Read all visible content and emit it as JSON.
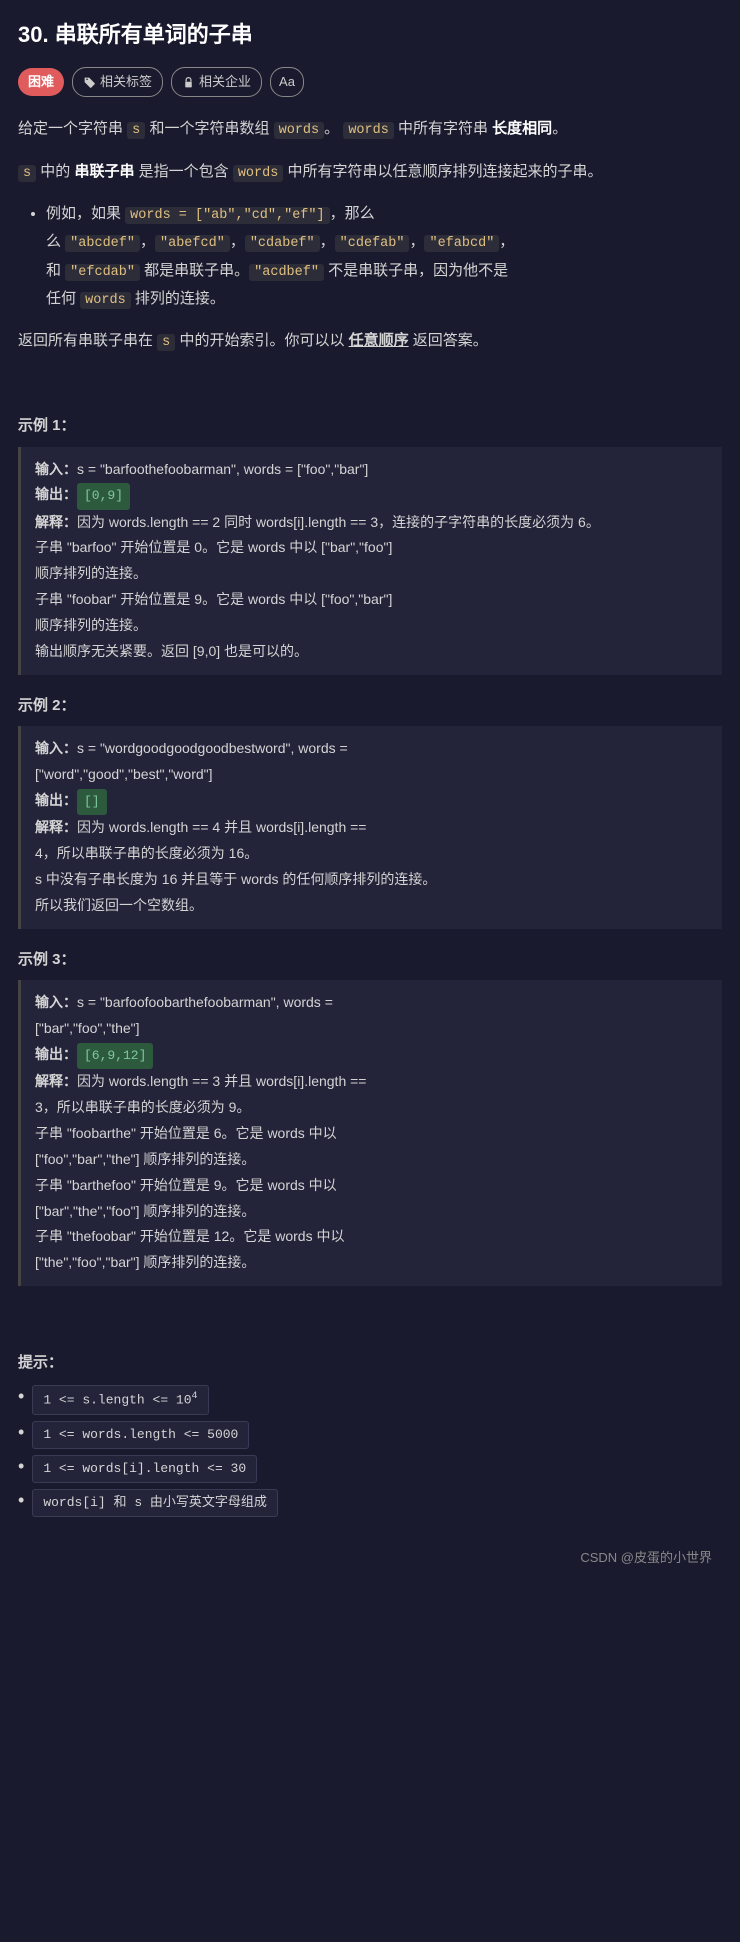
{
  "page": {
    "title": "30. 串联所有单词的子串",
    "difficulty": "困难",
    "tag_related_label": "相关标签",
    "tag_company_label": "相关企业",
    "tag_font_label": "Aa",
    "description_1": "给定一个字符串 s 和一个字符串数组 words。 words 中所有字符串 长度相同。",
    "description_2": "s 中的 串联子串 是指一个包含 words 中所有字符串以任意顺序排列连接起来的子串。",
    "example_note_intro": "例如，如果 words = [\"ab\",\"cd\",\"ef\"]，那么",
    "example_note_valid": "\"abcdef\"，\"abefcd\"，\"cdabef\"，\"cdefab\"，\"efabcd\"，和 \"efcdab\" 都是串联子串。",
    "example_note_invalid": "\"acdbef\" 不是串联子串，因为他不是任何 words 排列的连接。",
    "description_3": "返回所有串联子串在 s 中的开始索引。你可以以 任意顺序 返回答案。",
    "section_example1": "示例 1：",
    "section_example2": "示例 2：",
    "section_example3": "示例 3：",
    "ex1_input": "输入：s = \"barfoothefoobarman\", words = [\"foo\",\"bar\"]",
    "ex1_output": "输出：[0,9]",
    "ex1_output_val": "[0,9]",
    "ex1_explain_1": "解释：因为 words.length == 2 同时 words[i].length == 3，连接的子字符串的长度必须为 6。",
    "ex1_explain_2": "子串 \"barfoo\" 开始位置是 0。它是 words 中以 [\"bar\",\"foo\"] 顺序排列的连接。",
    "ex1_explain_3": "子串 \"foobar\" 开始位置是 9。它是 words 中以 [\"foo\",\"bar\"] 顺序排列的连接。",
    "ex1_explain_4": "输出顺序无关紧要。返回 [9,0] 也是可以的。",
    "ex2_input": "输入：s = \"wordgoodgoodgoodbestword\", words = [\"word\",\"good\",\"best\",\"word\"]",
    "ex2_output": "输出：[]",
    "ex2_output_val": "[]",
    "ex2_explain_1": "解释：因为 words.length == 4 并且 words[i].length == 4，所以串联子串的长度必须为 16。",
    "ex2_explain_2": "s 中没有子串长度为 16 并且等于 words 的任何顺序排列的连接。所以我们返回一个空数组。",
    "ex3_input": "输入：s = \"barfoofoobarthefoobarman\", words = [\"bar\",\"foo\",\"the\"]",
    "ex3_output": "输出：[6,9,12]",
    "ex3_output_val": "[6,9,12]",
    "ex3_explain_1": "解释：因为 words.length == 3 并且 words[i].length == 3，所以串联子串的长度必须为 9。",
    "ex3_explain_2": "子串 \"foobarthe\" 开始位置是 6。它是 words 中以 [\"foo\",\"bar\",\"the\"] 顺序排列的连接。",
    "ex3_explain_3": "子串 \"barthefoo\" 开始位置是 9。它是 words 中以 [\"bar\",\"the\",\"foo\"] 顺序排列的连接。",
    "ex3_explain_4": "子串 \"thefoobar\" 开始位置是 12。它是 words 中以 [\"the\",\"foo\",\"bar\"] 顺序排列的连接。",
    "hint_title": "提示：",
    "hint1": "1 <= s.length <= 10",
    "hint1_sup": "4",
    "hint2": "1 <= words.length <= 5000",
    "hint3": "1 <= words[i].length <= 30",
    "hint4": "words[i] 和 s 由小写英文字母组成",
    "footer": "CSDN @皮蛋的小世界"
  }
}
